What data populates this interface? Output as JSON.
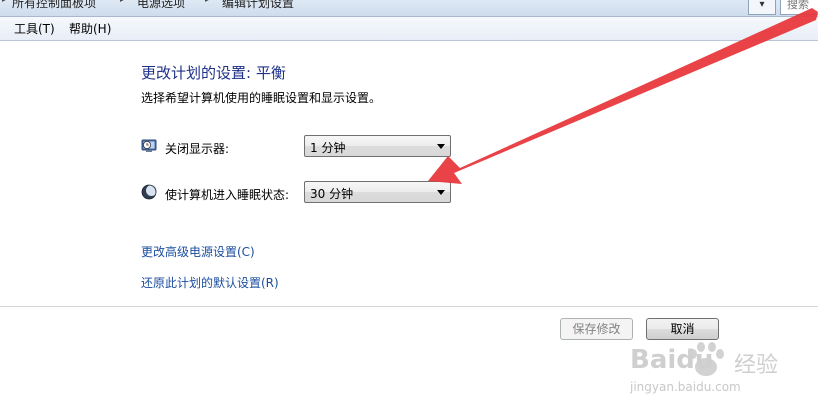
{
  "address_bar": {
    "crumb1": "所有控制面板项",
    "crumb2": "电源选项",
    "crumb3": "编辑计划设置",
    "search_placeholder": "搜索"
  },
  "menu": {
    "tools": "工具(T)",
    "help": "帮助(H)"
  },
  "main": {
    "title": "更改计划的设置: 平衡",
    "subtitle": "选择希望计算机使用的睡眠设置和显示设置。",
    "display_off": {
      "label": "关闭显示器:",
      "value": "1 分钟",
      "icon": "monitor-clock-icon"
    },
    "sleep": {
      "label": "使计算机进入睡眠状态:",
      "value": "30 分钟",
      "icon": "moon-icon"
    },
    "advanced_link": "更改高级电源设置(C)",
    "restore_link": "还原此计划的默认设置(R)"
  },
  "buttons": {
    "save": "保存修改",
    "cancel": "取消"
  },
  "watermark": {
    "logo": "Baidu",
    "experience": "经验",
    "url": "jingyan.baidu.com"
  },
  "colors": {
    "heading": "#1e3287",
    "link": "#1c4ea0",
    "annotation_arrow": "#e8383d"
  }
}
